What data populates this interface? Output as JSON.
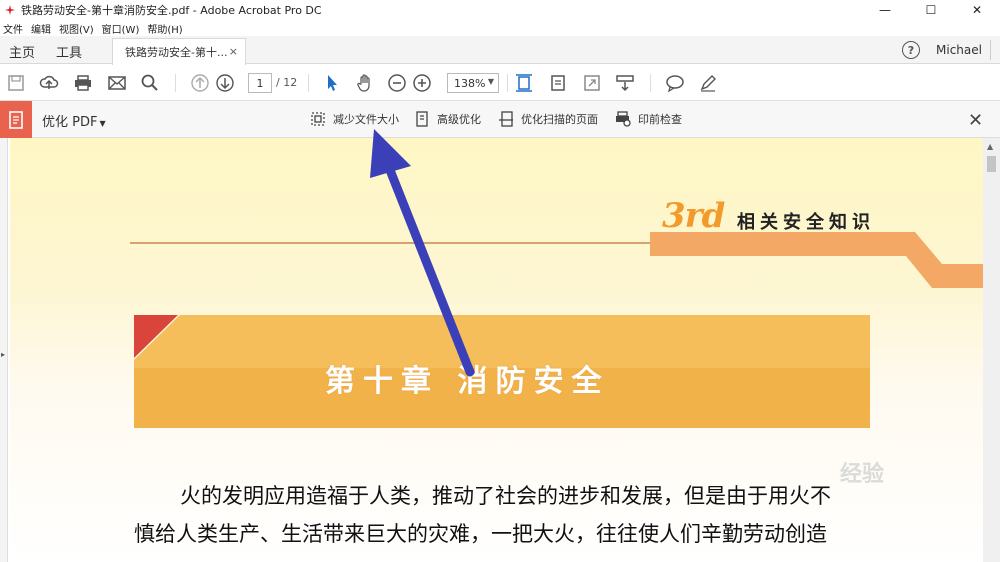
{
  "window": {
    "title": "铁路劳动安全-第十章消防安全.pdf - Adobe Acrobat Pro DC",
    "minimize": "—",
    "maximize": "☐",
    "close": "✕"
  },
  "menu": [
    "文件",
    "编辑",
    "视图(V)",
    "窗口(W)",
    "帮助(H)"
  ],
  "tabs": {
    "home": "主页",
    "tools": "工具",
    "document": "铁路劳动安全-第十...",
    "close": "×"
  },
  "account": {
    "help": "?",
    "user": "Michael"
  },
  "toolbar": {
    "page_current": "1",
    "page_total": "/ 12",
    "zoom": "138%"
  },
  "optimize": {
    "title": "优化 PDF",
    "items": [
      "减少文件大小",
      "高级优化",
      "优化扫描的页面",
      "印前检查"
    ],
    "close": "✕"
  },
  "document": {
    "badge": "3rd",
    "badge_subtitle": "相关安全知识",
    "chapter_title": "第十章  消防安全",
    "lines": [
      "火的发明应用造福于人类，推动了社会的进步和发展，但是由于用火不",
      "慎给人类生产、生活带来巨大的灾难，一把大火，往往使人们辛勤劳动创造"
    ]
  },
  "watermark": "经验",
  "colors": {
    "accent": "#e8624e",
    "annotation_arrow": "#3b3fb8",
    "banner_orange": "#f2b24a",
    "badge_orange": "#f39a2c"
  }
}
